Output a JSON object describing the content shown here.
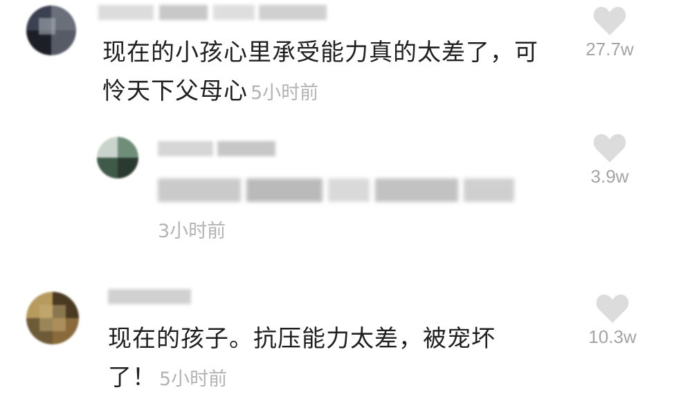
{
  "comments": [
    {
      "text": "现在的小孩心里承受能力真的太差了，可怜天下父母心",
      "time": "5小时前",
      "likes": "27.7w",
      "avatar_colors": [
        "#3b4150",
        "#1d1f27",
        "#6a6f7a",
        "#a9adb5",
        "#2c2f38",
        "#565b66"
      ]
    },
    {
      "time": "3小时前",
      "likes": "3.9w",
      "avatar_colors": [
        "#6f8e7a",
        "#3f5a49",
        "#c9d4cc",
        "#2b3a31",
        "#8fa597",
        "#e6ece8"
      ]
    },
    {
      "text": "现在的孩子。抗压能力太差，被宠坏了！",
      "time": "5小时前",
      "likes": "10.3w",
      "avatar_colors": [
        "#8a6a3a",
        "#4a3a22",
        "#b79a5d",
        "#2e2416",
        "#6d5a36",
        "#c9b27c"
      ]
    }
  ],
  "colors": {
    "time_gray": "#b3b3b3",
    "like_gray": "#dcdcdc",
    "count_gray": "#a4a4a4"
  }
}
